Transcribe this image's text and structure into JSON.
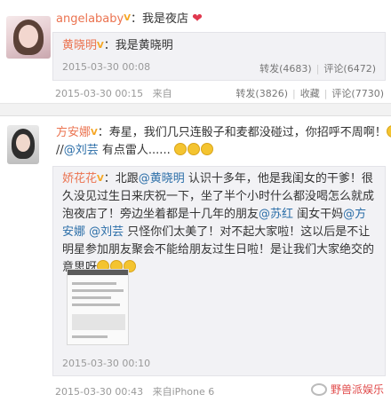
{
  "post1": {
    "user": "angelababy",
    "text": "：我是夜店",
    "repost": {
      "user": "黄晓明",
      "text": "：我是黄晓明",
      "time": "2015-03-30 00:08",
      "forward": "转发(4683)",
      "comment": "评论(6472)"
    },
    "time": "2015-03-30 00:15",
    "source": "来自",
    "forward": "转发(3826)",
    "favorite": "收藏",
    "comment": "评论(7730)"
  },
  "post2": {
    "user": "方安娜",
    "text": "：寿星，我们几只连骰子和麦都没碰过，你招呼不周啊！",
    "text2_prefix": "//",
    "text2_user": "@刘芸",
    "text2_suffix": " 有点雷人......",
    "repost": {
      "user": "娇花花",
      "seg1": "：北跟",
      "mention1": "@黄晓明",
      "seg2": " 认识十多年，他是我闺女的干爹！很久没见过生日来庆祝一下，坐了半个小时什么都没喝怎么就成泡夜店了！旁边坐着都是十几年的朋友",
      "mention2": "@苏红",
      "seg3": " 闺女干妈",
      "mention3": "@方安娜",
      "seg4": " ",
      "mention4": "@刘芸",
      "seg5": " 只怪你们太美了！对不起大家啦！这以后是不让明星参加朋友聚会不能给朋友过生日啦！是让我们大家绝交的意思呀",
      "time": "2015-03-30 00:10"
    },
    "time": "2015-03-30 00:43",
    "source": "来自iPhone 6"
  },
  "watermark": "野兽派娱乐",
  "colors": {
    "username": "#eb7350",
    "link": "#2b6ea8",
    "meta": "#999999"
  }
}
